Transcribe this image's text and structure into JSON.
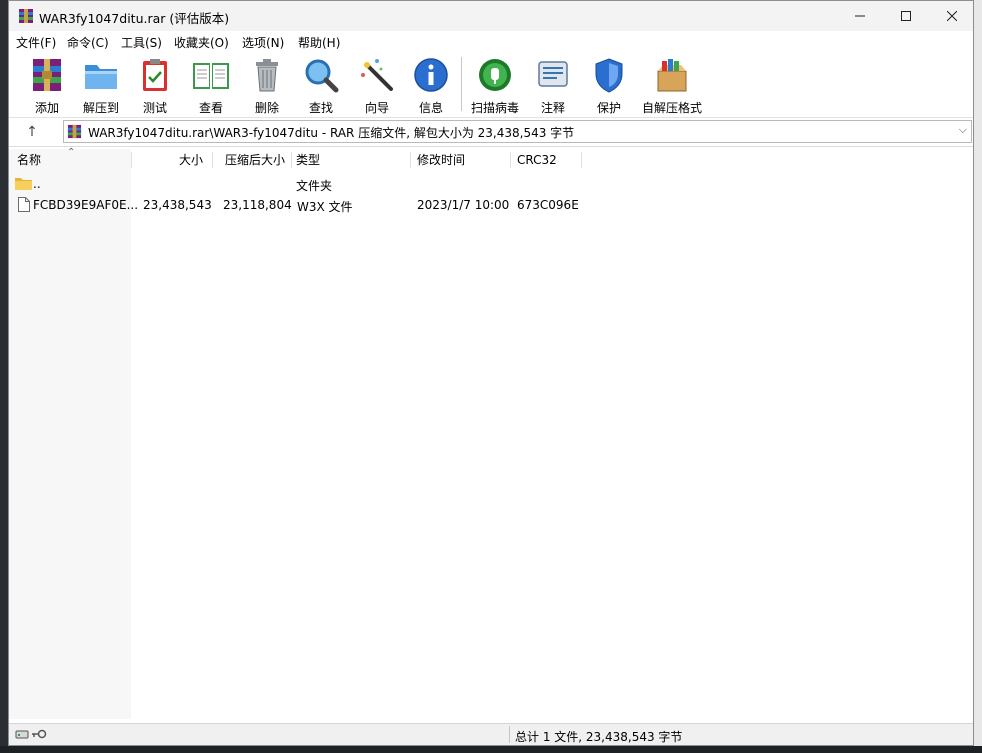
{
  "window": {
    "title": "WAR3fy1047ditu.rar (评估版本)"
  },
  "menu": [
    "文件(F)",
    "命令(C)",
    "工具(S)",
    "收藏夹(O)",
    "选项(N)",
    "帮助(H)"
  ],
  "toolbar": {
    "add": "添加",
    "extract_to": "解压到",
    "test": "测试",
    "view": "查看",
    "delete": "删除",
    "find": "查找",
    "wizard": "向导",
    "info": "信息",
    "virus_scan": "扫描病毒",
    "comment": "注释",
    "protect": "保护",
    "sfx": "自解压格式"
  },
  "address": {
    "path": "WAR3fy1047ditu.rar\\WAR3-fy1047ditu - RAR 压缩文件, 解包大小为 23,438,543 字节"
  },
  "columns": {
    "name": "名称",
    "size": "大小",
    "packed": "压缩后大小",
    "type": "类型",
    "modified": "修改时间",
    "crc": "CRC32"
  },
  "rows": [
    {
      "name": "..",
      "size": "",
      "packed": "",
      "type": "文件夹",
      "modified": "",
      "crc": ""
    },
    {
      "name": "FCBD39E9AF0E...",
      "size": "23,438,543",
      "packed": "23,118,804",
      "type": "W3X 文件",
      "modified": "2023/1/7 10:00",
      "crc": "673C096E"
    }
  ],
  "status": {
    "text": "总计 1 文件, 23,438,543 字节"
  }
}
